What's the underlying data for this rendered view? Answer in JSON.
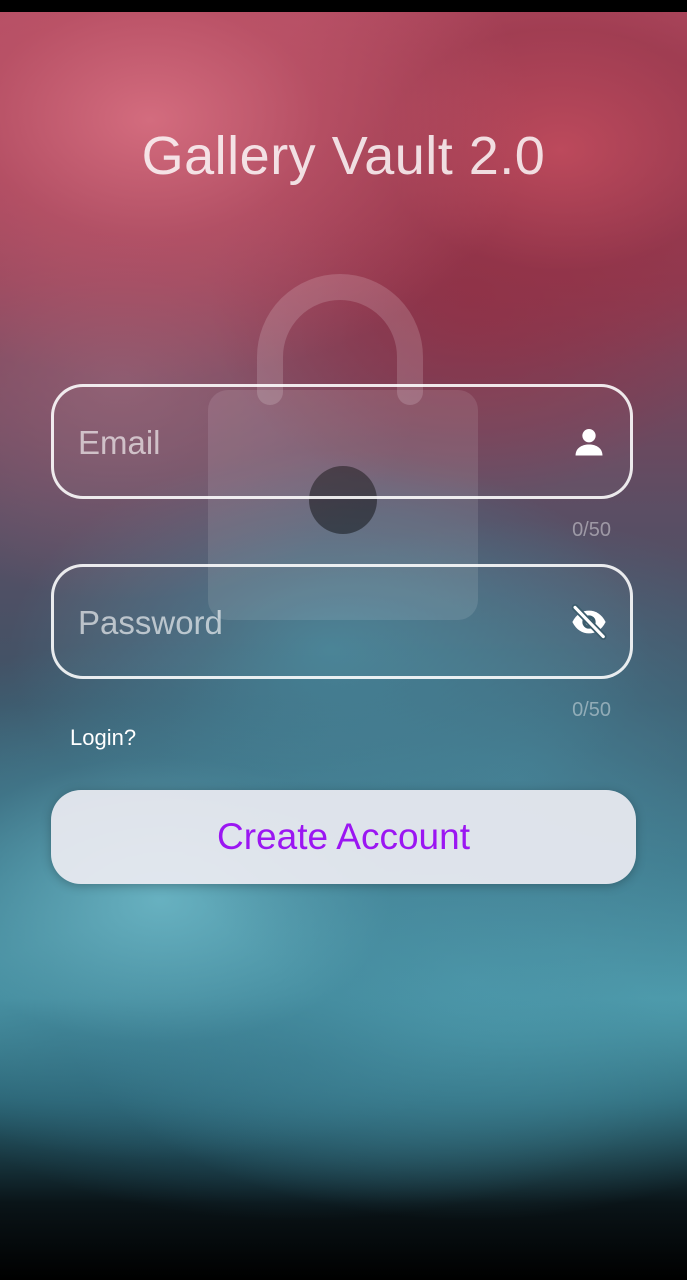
{
  "app": {
    "title": "Gallery Vault 2.0"
  },
  "form": {
    "email": {
      "placeholder": "Email",
      "value": "",
      "counter": "0/50",
      "icon": "person-icon"
    },
    "password": {
      "placeholder": "Password",
      "value": "",
      "counter": "0/50",
      "icon": "eye-off-icon"
    },
    "login_link": "Login?",
    "submit_label": "Create Account"
  },
  "background": {
    "watermark_icon": "padlock-icon"
  },
  "colors": {
    "accent": "#9b16f2",
    "button_bg": "#ececf2",
    "field_border": "#ffffff",
    "top_tone": "#b24d63",
    "bottom_tone": "#4c98a8"
  }
}
